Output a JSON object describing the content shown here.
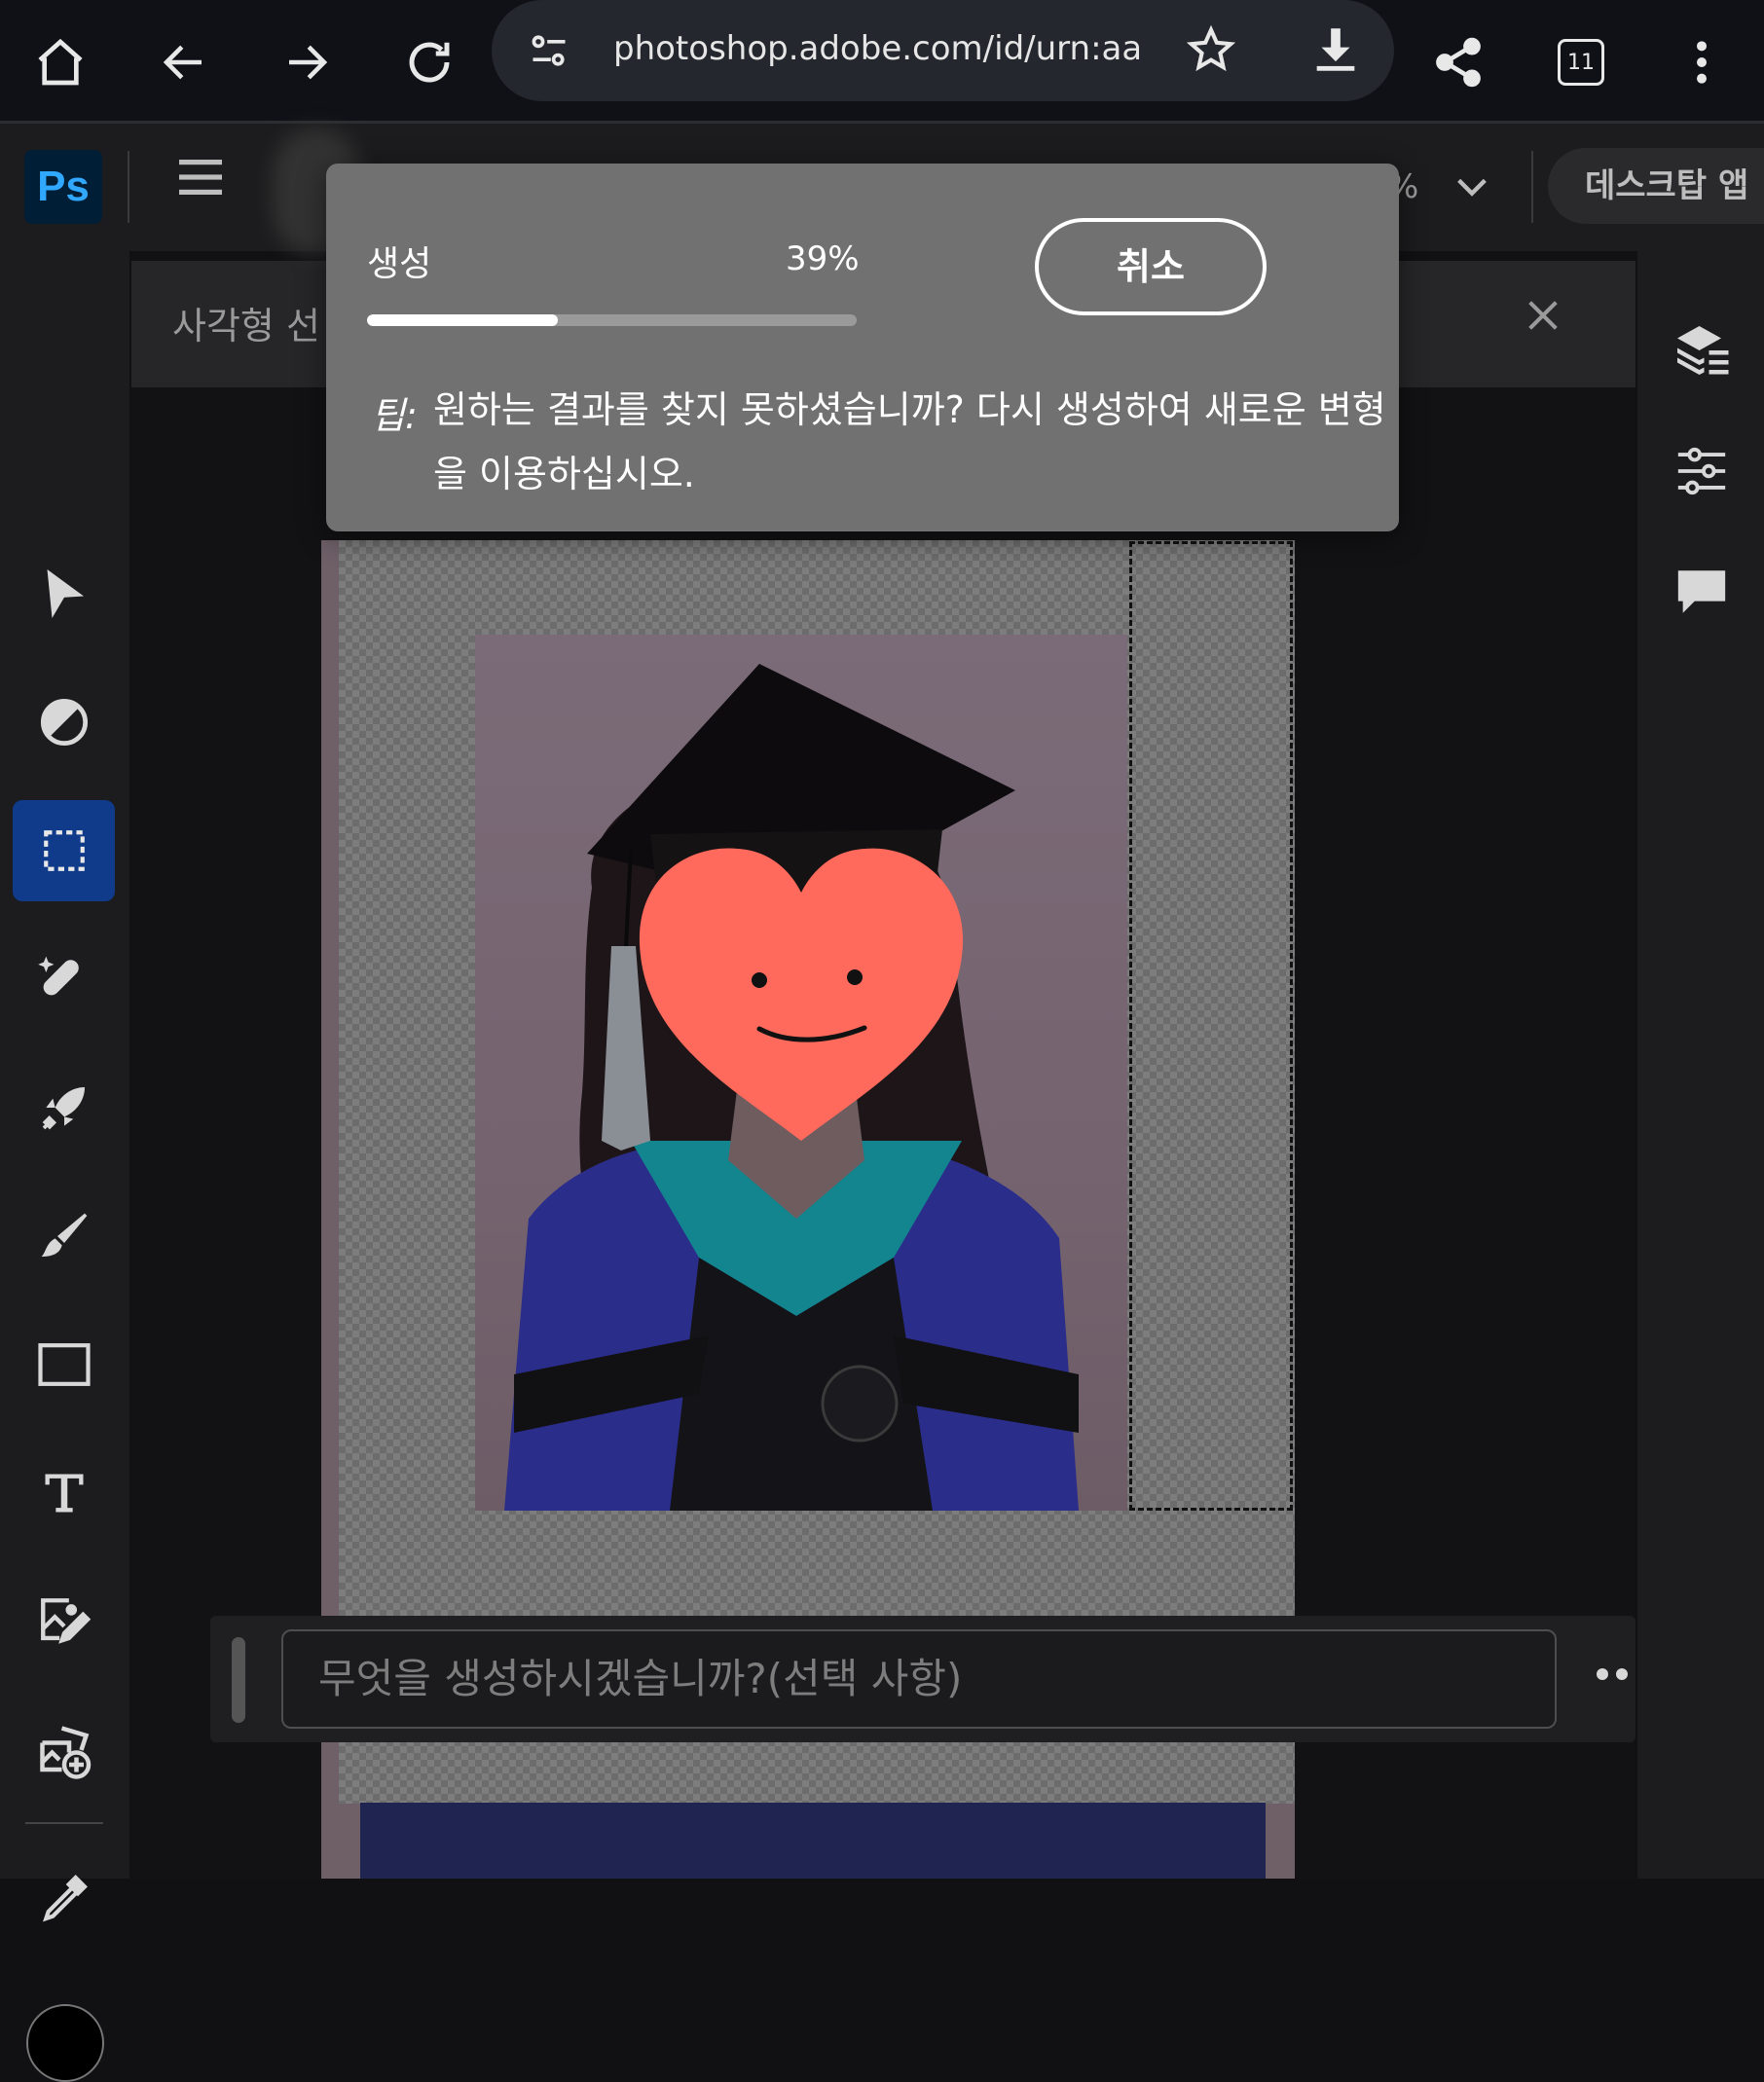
{
  "browser": {
    "url": "photoshop.adobe.com/id/urn:aaid:sc",
    "tab_count": "11"
  },
  "app": {
    "logo": "Ps",
    "desktop_button": "데스크탑 앱",
    "zoom_fragment": "%"
  },
  "options_bar": {
    "title": "사각형 선"
  },
  "left_tools": [
    {
      "name": "move-tool",
      "icon": "arrow-pointer-icon"
    },
    {
      "name": "adjust-tool",
      "icon": "circle-half-icon"
    },
    {
      "name": "rectangle-select-tool",
      "icon": "dashed-rectangle-icon",
      "active": true
    },
    {
      "name": "healing-tool",
      "icon": "bandage-sparkle-icon"
    },
    {
      "name": "quick-actions-tool",
      "icon": "rocket-icon"
    },
    {
      "name": "brush-tool",
      "icon": "brush-icon"
    },
    {
      "name": "shape-tool",
      "icon": "rectangle-icon"
    },
    {
      "name": "type-tool",
      "icon": "text-t-icon"
    },
    {
      "name": "place-image-tool",
      "icon": "image-edit-icon"
    },
    {
      "name": "add-image-tool",
      "icon": "image-add-icon"
    },
    {
      "name": "eyedropper-tool",
      "icon": "eyedropper-icon"
    }
  ],
  "foreground_color": "#000000",
  "right_tools": [
    {
      "name": "layers-button",
      "icon": "layers-icon"
    },
    {
      "name": "adjustments-button",
      "icon": "sliders-icon"
    },
    {
      "name": "comments-button",
      "icon": "speech-bubble-icon"
    }
  ],
  "generation": {
    "label": "생성",
    "percent": "39%",
    "progress": 0.39,
    "cancel_label": "취소",
    "tip_label": "팁:",
    "tip_text": "원하는 결과를 찾지 못하셨습니까? 다시 생성하여 새로운 변형을 이용하십시오."
  },
  "prompt": {
    "placeholder": "무엇을 생성하시겠습니까?(선택 사항)"
  },
  "colors": {
    "accent": "#103a8a",
    "ps_blue": "#31a8ff",
    "heart": "#ff6a5c"
  }
}
